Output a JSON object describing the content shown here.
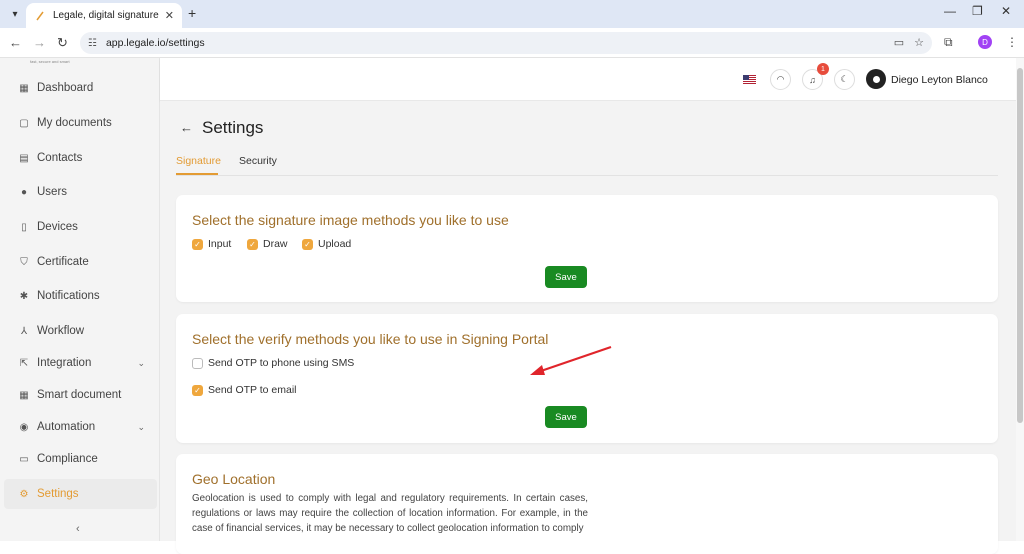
{
  "browser": {
    "tab_title": "Legale, digital signature",
    "url": "app.legale.io/settings",
    "profile_initial": "D"
  },
  "sidebar": {
    "logo_tagline": "fast, secure and smart",
    "items": [
      {
        "label": "Dashboard",
        "icon": "dashboard-icon"
      },
      {
        "label": "My documents",
        "icon": "folder-icon"
      },
      {
        "label": "Contacts",
        "icon": "contacts-icon"
      },
      {
        "label": "Users",
        "icon": "user-icon"
      },
      {
        "label": "Devices",
        "icon": "device-icon"
      },
      {
        "label": "Certificate",
        "icon": "shield-icon"
      },
      {
        "label": "Notifications",
        "icon": "bell-icon"
      },
      {
        "label": "Workflow",
        "icon": "workflow-icon"
      },
      {
        "label": "Integration",
        "icon": "integration-icon"
      },
      {
        "label": "Smart document",
        "icon": "smart-document-icon"
      },
      {
        "label": "Automation",
        "icon": "automation-icon"
      },
      {
        "label": "Compliance",
        "icon": "compliance-icon"
      },
      {
        "label": "Settings",
        "icon": "gear-icon"
      }
    ],
    "collapse_glyph": "‹"
  },
  "header": {
    "notification_count": "1",
    "user_name": "Diego Leyton Blanco"
  },
  "page": {
    "title": "Settings",
    "tabs": [
      "Signature",
      "Security"
    ]
  },
  "signature_card": {
    "heading": "Select the signature image methods you like to use",
    "options": [
      "Input",
      "Draw",
      "Upload"
    ],
    "save_label": "Save"
  },
  "verify_card": {
    "heading": "Select the verify methods you like to use in Signing Portal",
    "option_sms": "Send OTP to phone using SMS",
    "option_email": "Send OTP to email",
    "save_label": "Save"
  },
  "geo_card": {
    "heading": "Geo Location",
    "text": "Geolocation is used to comply with legal and regulatory requirements. In certain cases, regulations or laws may require the collection of location information. For example, in the case of financial services, it may be necessary to collect geolocation information to comply"
  },
  "colors": {
    "accent": "#e39b33",
    "heading": "#a0702c",
    "save_green": "#198a22",
    "annotation_arrow": "#e0252b"
  }
}
